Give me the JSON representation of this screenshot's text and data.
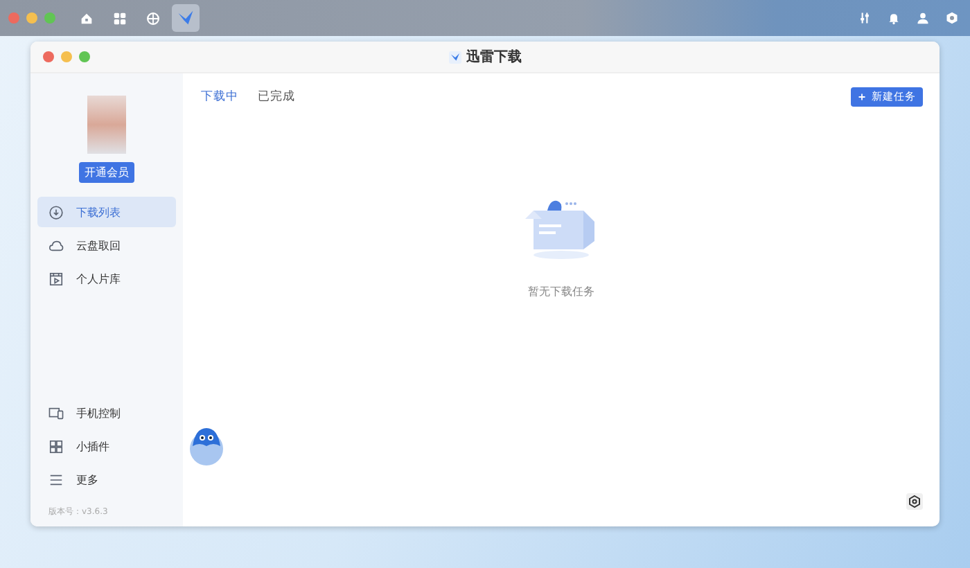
{
  "menubar": {
    "apps": [
      {
        "selected": false
      },
      {
        "selected": false
      },
      {
        "selected": false
      },
      {
        "selected": true
      }
    ]
  },
  "window": {
    "title": "迅雷下载"
  },
  "sidebar": {
    "member_button": "开通会员",
    "items": [
      {
        "label": "下载列表",
        "selected": true
      },
      {
        "label": "云盘取回",
        "selected": false
      },
      {
        "label": "个人片库",
        "selected": false
      }
    ],
    "bottom_items": [
      {
        "label": "手机控制"
      },
      {
        "label": "小插件"
      },
      {
        "label": "更多"
      }
    ],
    "version": "版本号：v3.6.3"
  },
  "tabs": [
    {
      "label": "下载中",
      "selected": true
    },
    {
      "label": "已完成",
      "selected": false
    }
  ],
  "new_task_button": "新建任务",
  "empty_state": {
    "message": "暂无下载任务"
  }
}
